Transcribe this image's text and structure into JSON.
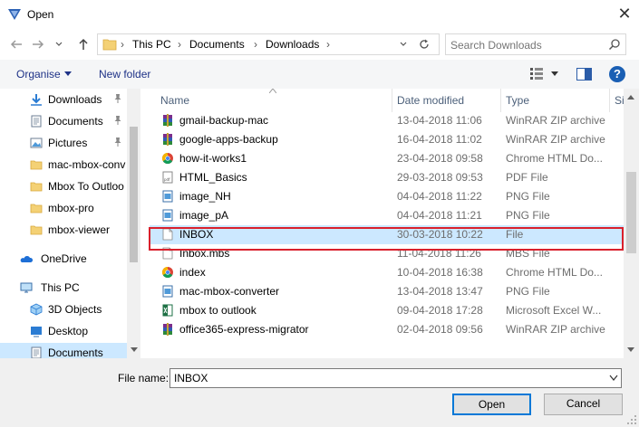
{
  "window": {
    "title": "Open",
    "close_glyph": "✕"
  },
  "nav": {
    "back_icon": "back-arrow-icon",
    "forward_icon": "forward-arrow-icon",
    "recent_icon": "chevron-down-icon",
    "up_icon": "up-arrow-icon"
  },
  "address": {
    "crumbs": [
      "This PC",
      "Documents",
      "Downloads"
    ],
    "separator": "›"
  },
  "search": {
    "placeholder": "Search Downloads"
  },
  "toolbar": {
    "organise": "Organise",
    "new_folder": "New folder",
    "help": "?"
  },
  "sidebar": {
    "items": [
      {
        "label": "Downloads",
        "icon": "download-icon",
        "pinned": true
      },
      {
        "label": "Documents",
        "icon": "document-icon",
        "pinned": true
      },
      {
        "label": "Pictures",
        "icon": "pictures-icon",
        "pinned": true
      },
      {
        "label": "mac-mbox-conv",
        "icon": "folder-icon",
        "pinned": false
      },
      {
        "label": "Mbox To Outloo",
        "icon": "folder-icon",
        "pinned": false
      },
      {
        "label": "mbox-pro",
        "icon": "folder-icon",
        "pinned": false
      },
      {
        "label": "mbox-viewer",
        "icon": "folder-icon",
        "pinned": false
      },
      {
        "label": "OneDrive",
        "icon": "onedrive-icon",
        "pinned": false
      },
      {
        "label": "This PC",
        "icon": "computer-icon",
        "pinned": false
      },
      {
        "label": "3D Objects",
        "icon": "3d-objects-icon",
        "pinned": false
      },
      {
        "label": "Desktop",
        "icon": "desktop-icon",
        "pinned": false
      },
      {
        "label": "Documents",
        "icon": "document-icon",
        "pinned": false
      }
    ]
  },
  "columns": {
    "name": "Name",
    "date": "Date modified",
    "type": "Type",
    "size": "Si"
  },
  "files": [
    {
      "name": "gmail-backup-mac",
      "date": "13-04-2018 11:06",
      "type": "WinRAR ZIP archive",
      "icon": "winrar-icon"
    },
    {
      "name": "google-apps-backup",
      "date": "16-04-2018 11:02",
      "type": "WinRAR ZIP archive",
      "icon": "winrar-icon"
    },
    {
      "name": "how-it-works1",
      "date": "23-04-2018 09:58",
      "type": "Chrome HTML Do...",
      "icon": "chrome-icon"
    },
    {
      "name": "HTML_Basics",
      "date": "29-03-2018 09:53",
      "type": "PDF File",
      "icon": "pdf-icon"
    },
    {
      "name": "image_NH",
      "date": "04-04-2018 11:22",
      "type": "PNG File",
      "icon": "image-icon"
    },
    {
      "name": "image_pA",
      "date": "04-04-2018 11:21",
      "type": "PNG File",
      "icon": "image-icon"
    },
    {
      "name": "INBOX",
      "date": "30-03-2018 10:22",
      "type": "File",
      "icon": "blank-file-icon",
      "selected": true
    },
    {
      "name": "Inbox.mbs",
      "date": "11-04-2018 11:26",
      "type": "MBS File",
      "icon": "blank-file-icon"
    },
    {
      "name": "index",
      "date": "10-04-2018 16:38",
      "type": "Chrome HTML Do...",
      "icon": "chrome-icon"
    },
    {
      "name": "mac-mbox-converter",
      "date": "13-04-2018 13:47",
      "type": "PNG File",
      "icon": "image-icon"
    },
    {
      "name": "mbox to outlook",
      "date": "09-04-2018 17:28",
      "type": "Microsoft Excel W...",
      "icon": "excel-icon"
    },
    {
      "name": "office365-express-migrator",
      "date": "02-04-2018 09:56",
      "type": "WinRAR ZIP archive",
      "icon": "winrar-icon"
    }
  ],
  "footer": {
    "file_name_label": "File name:",
    "file_name_value": "INBOX",
    "open": "Open",
    "cancel": "Cancel"
  },
  "colors": {
    "accent": "#0078d7",
    "selected_row": "#cce8ff",
    "highlight_box": "#d9202c",
    "link": "#1e3287"
  }
}
